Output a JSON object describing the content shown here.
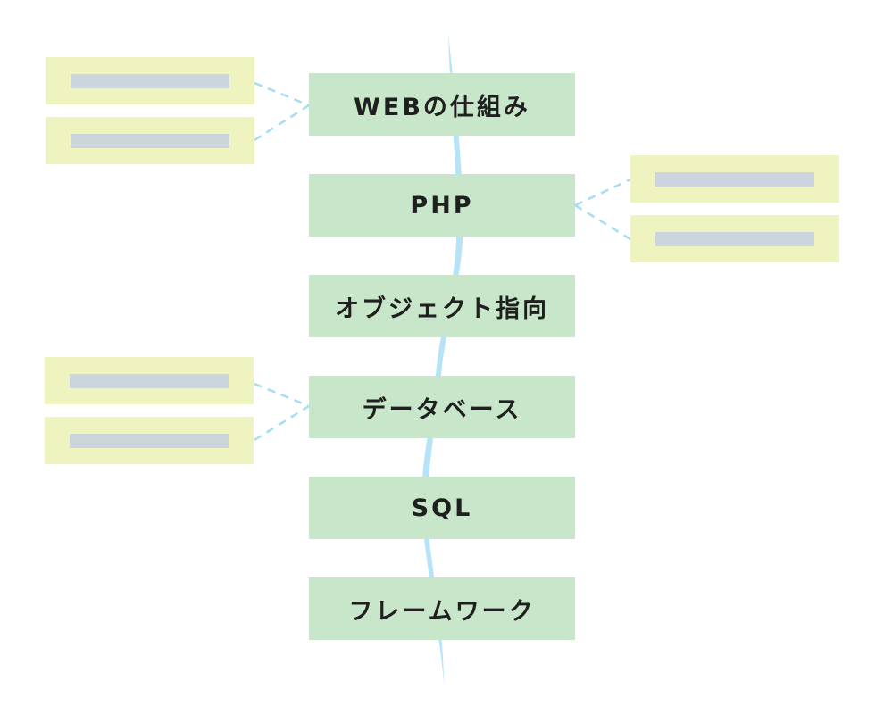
{
  "colors": {
    "step_fill": "#c8e6c9",
    "note_fill": "#eef3c0",
    "note_bar": "#ccd5dd",
    "connector": "#a8dcf3",
    "spine": "#b6e3f7",
    "text": "#1f1f1f"
  },
  "steps": [
    {
      "label": "WEBの仕組み"
    },
    {
      "label": "PHP"
    },
    {
      "label": "オブジェクト指向"
    },
    {
      "label": "データベース"
    },
    {
      "label": "SQL"
    },
    {
      "label": "フレームワーク"
    }
  ],
  "note_groups": [
    {
      "attached_step": "WEBの仕組み",
      "side": "left",
      "notes": 2
    },
    {
      "attached_step": "PHP",
      "side": "right",
      "notes": 2
    },
    {
      "attached_step": "データベース",
      "side": "left",
      "notes": 2
    }
  ]
}
